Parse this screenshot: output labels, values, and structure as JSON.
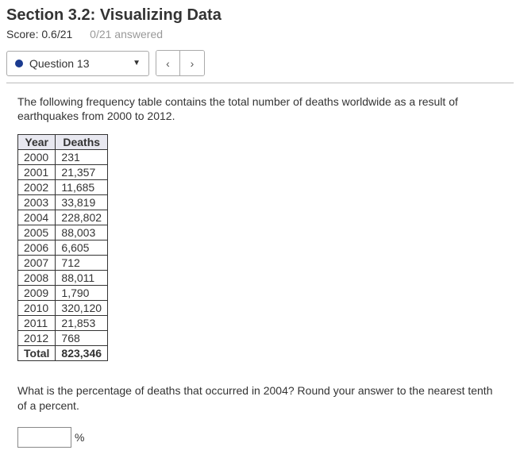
{
  "header": {
    "title": "Section 3.2: Visualizing Data",
    "score_label": "Score: 0.6/21",
    "answered_label": "0/21 answered"
  },
  "nav": {
    "question_label": "Question 13",
    "prev_glyph": "‹",
    "next_glyph": "›"
  },
  "intro": "The following frequency table contains the total number of deaths worldwide as a result of earthquakes from 2000 to 2012.",
  "table": {
    "headers": {
      "year": "Year",
      "deaths": "Deaths"
    },
    "rows": [
      {
        "year": "2000",
        "deaths": "231"
      },
      {
        "year": "2001",
        "deaths": "21,357"
      },
      {
        "year": "2002",
        "deaths": "11,685"
      },
      {
        "year": "2003",
        "deaths": "33,819"
      },
      {
        "year": "2004",
        "deaths": "228,802"
      },
      {
        "year": "2005",
        "deaths": "88,003"
      },
      {
        "year": "2006",
        "deaths": "6,605"
      },
      {
        "year": "2007",
        "deaths": "712"
      },
      {
        "year": "2008",
        "deaths": "88,011"
      },
      {
        "year": "2009",
        "deaths": "1,790"
      },
      {
        "year": "2010",
        "deaths": "320,120"
      },
      {
        "year": "2011",
        "deaths": "21,853"
      },
      {
        "year": "2012",
        "deaths": "768"
      }
    ],
    "total": {
      "year": "Total",
      "deaths": "823,346"
    }
  },
  "prompt": "What is the percentage of deaths that occurred in 2004? Round your answer to the nearest tenth of a percent.",
  "answer": {
    "value": "",
    "unit": "%"
  }
}
